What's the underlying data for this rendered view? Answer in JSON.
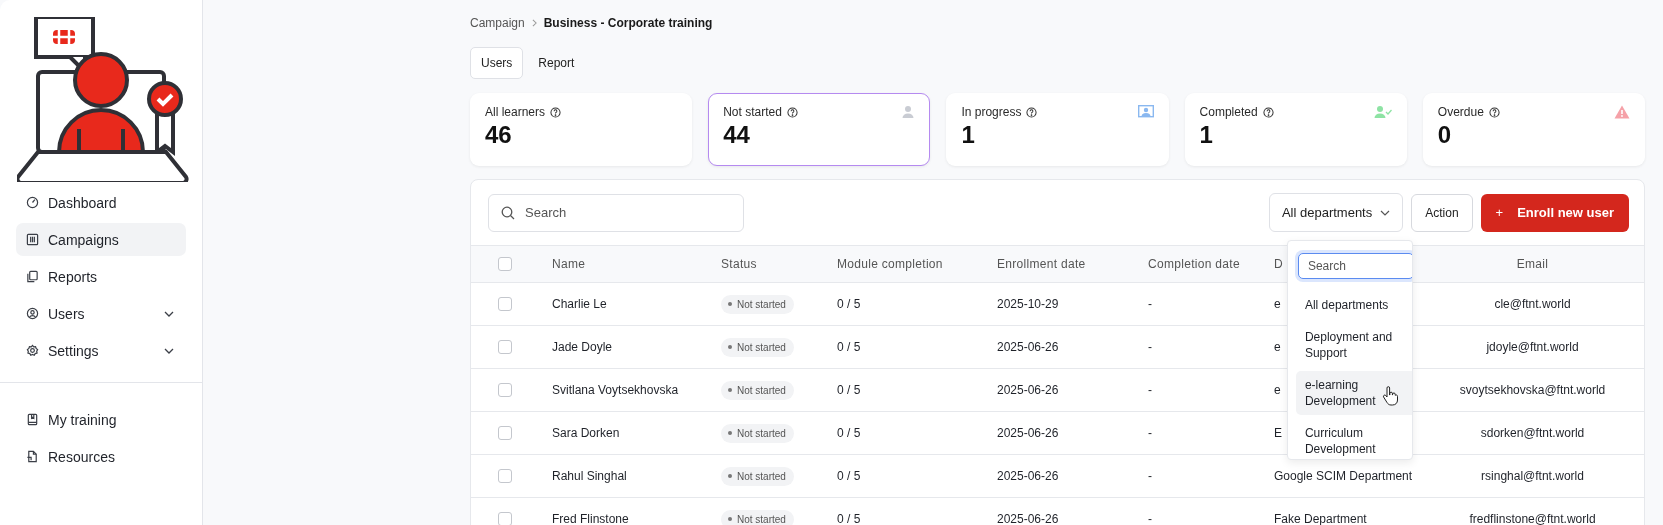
{
  "sidebar": {
    "nav": [
      {
        "label": "Dashboard",
        "selected": false,
        "expandable": false
      },
      {
        "label": "Campaigns",
        "selected": true,
        "expandable": false
      },
      {
        "label": "Reports",
        "selected": false,
        "expandable": false
      },
      {
        "label": "Users",
        "selected": false,
        "expandable": true
      },
      {
        "label": "Settings",
        "selected": false,
        "expandable": true
      }
    ],
    "bottom": [
      {
        "label": "My training",
        "selected": false,
        "expandable": false
      },
      {
        "label": "Resources",
        "selected": false,
        "expandable": false
      }
    ]
  },
  "breadcrumb": [
    "Campaign",
    "Business - Corporate training"
  ],
  "tabs": [
    {
      "label": "Users",
      "selected": true
    },
    {
      "label": "Report",
      "selected": false
    }
  ],
  "stats": [
    {
      "label": "All learners",
      "value": "46",
      "selected": false
    },
    {
      "label": "Not started",
      "value": "44",
      "selected": true
    },
    {
      "label": "In progress",
      "value": "1",
      "selected": false
    },
    {
      "label": "Completed",
      "value": "1",
      "selected": false
    },
    {
      "label": "Overdue",
      "value": "0",
      "selected": false
    }
  ],
  "toolbar": {
    "search": {
      "placeholder": "Search"
    },
    "department_filter": {
      "value": "All departments",
      "open": true
    },
    "action_button": "Action",
    "enroll_button": "+",
    "enroll_label": "Enroll new user"
  },
  "table": {
    "select_all": {
      "checked": false
    },
    "columns": [
      "Name",
      "Status",
      "Module completion",
      "Enrollment date",
      "Completion date",
      "D",
      "Email"
    ],
    "rows": [
      {
        "checked": false,
        "name": "Charlie Le",
        "status": "Not started",
        "modules": "0 / 5",
        "enrolled": "2025-10-29",
        "completed": "-",
        "department": "e",
        "email": "cle@ftnt.world"
      },
      {
        "checked": false,
        "name": "Jade Doyle",
        "status": "Not started",
        "modules": "0 / 5",
        "enrolled": "2025-06-26",
        "completed": "-",
        "department": "e",
        "email": "jdoyle@ftnt.world"
      },
      {
        "checked": false,
        "name": "Svitlana Voytsekhovska",
        "status": "Not started",
        "modules": "0 / 5",
        "enrolled": "2025-06-26",
        "completed": "-",
        "department": "e",
        "email": "svoytsekhovska@ftnt.world"
      },
      {
        "checked": false,
        "name": "Sara Dorken",
        "status": "Not started",
        "modules": "0 / 5",
        "enrolled": "2025-06-26",
        "completed": "-",
        "department": "E",
        "email": "sdorken@ftnt.world"
      },
      {
        "checked": false,
        "name": "Rahul Singhal",
        "status": "Not started",
        "modules": "0 / 5",
        "enrolled": "2025-06-26",
        "completed": "-",
        "department": "Google SCIM Department",
        "email": "rsinghal@ftnt.world"
      },
      {
        "checked": false,
        "name": "Fred Flinstone",
        "status": "Not started",
        "modules": "0 / 5",
        "enrolled": "2025-06-26",
        "completed": "-",
        "department": "Fake Department",
        "email": "fredflinstone@ftnt.world"
      }
    ]
  },
  "department_dropdown": {
    "search": {
      "placeholder": "Search"
    },
    "options": [
      {
        "label": "All departments",
        "highlighted": false
      },
      {
        "label": "Deployment and Support",
        "highlighted": false
      },
      {
        "label": "e-learning Development",
        "highlighted": true
      },
      {
        "label": "Curriculum Development",
        "highlighted": false
      }
    ]
  }
}
